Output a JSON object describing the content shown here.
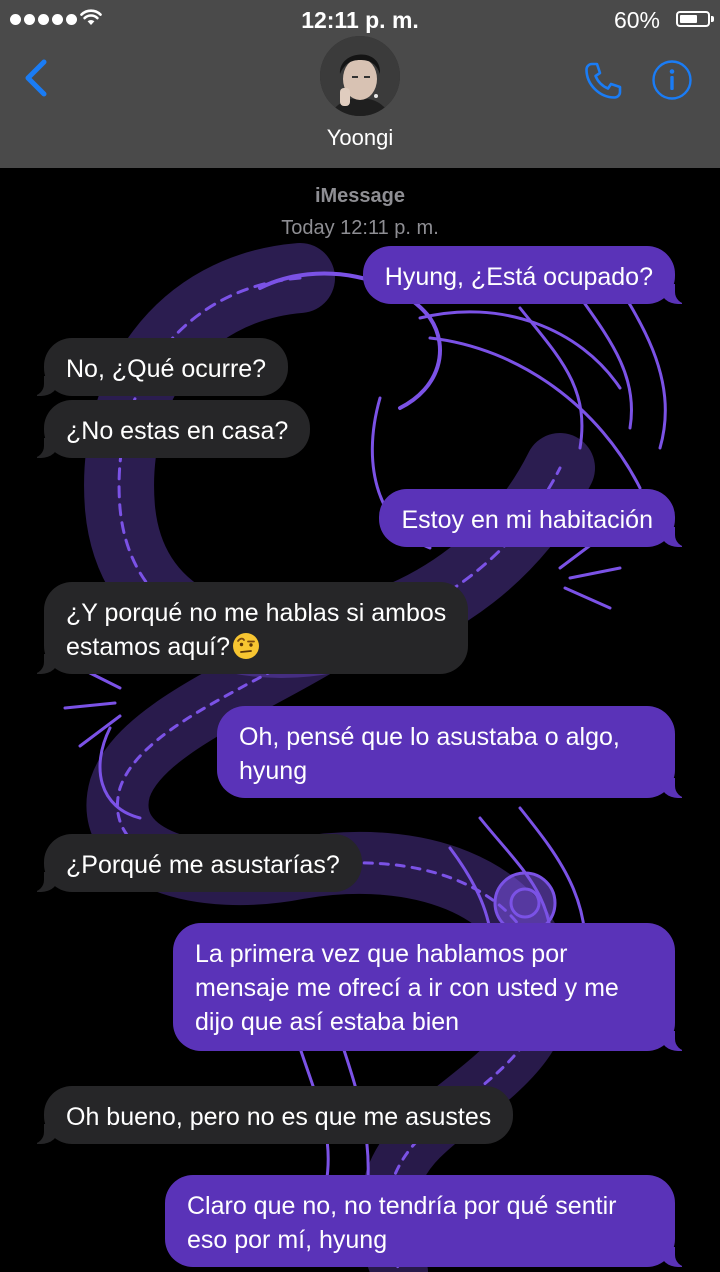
{
  "status_bar": {
    "time": "12:11 p. m.",
    "battery": "60%",
    "battery_level": 0.6
  },
  "header": {
    "contact_name": "Yoongi",
    "back_icon": "chevron-left-icon",
    "call_icon": "phone-icon",
    "info_icon": "info-icon",
    "accent_color": "#1a7cf5"
  },
  "thread": {
    "service": "iMessage",
    "timestamp": "Today 12:11 p. m.",
    "sent_color": "#5a33b8",
    "received_color": "#262628",
    "messages": [
      {
        "from": "me",
        "text": "Hyung, ¿Está ocupado?"
      },
      {
        "from": "them",
        "text": "No, ¿Qué ocurre?"
      },
      {
        "from": "them",
        "text": "¿No estas en casa?"
      },
      {
        "from": "me",
        "text": "Estoy en mi habitación"
      },
      {
        "from": "them",
        "text": "¿Y porqué no me hablas si ambos",
        "text2": "estamos aquí?",
        "emoji": "raised-eyebrow-face"
      },
      {
        "from": "me",
        "text": "Oh, pensé que lo asustaba o algo,",
        "text2": "hyung"
      },
      {
        "from": "them",
        "text": "¿Porqué me asustarías?"
      },
      {
        "from": "me",
        "text": "La primera vez que hablamos por",
        "text2": "mensaje me ofrecí a ir con usted y me",
        "text3": "dijo que así estaba bien"
      },
      {
        "from": "them",
        "text": "Oh bueno, pero no es que me asustes"
      },
      {
        "from": "me",
        "text": "Claro que no, no tendría por qué sentir",
        "text2": "eso por mí, hyung"
      }
    ]
  }
}
